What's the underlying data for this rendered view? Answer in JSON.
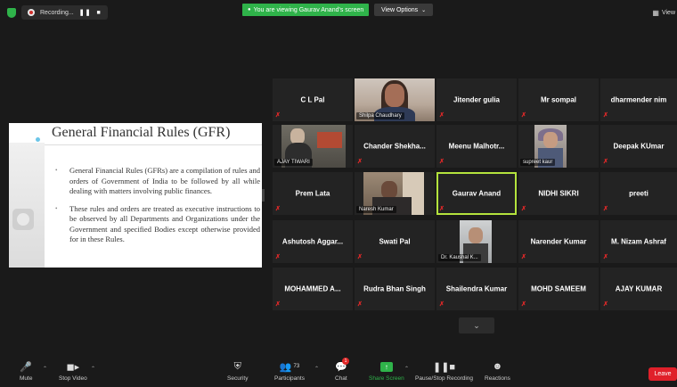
{
  "topbar": {
    "recording_label": "Recording...",
    "viewing_banner": "You are viewing Gaurav Anand's screen",
    "view_options_label": "View Options",
    "view_label": "View"
  },
  "slide": {
    "title": "General Financial Rules (GFR)",
    "bullets": [
      "General Financial Rules (GFRs) are a compilation of rules and orders of Government of India to be followed by all while dealing with matters involving public finances.",
      "These rules and orders are treated as executive instructions to be observed by all Departments and Organizations under the Government and specified Bodies except otherwise provided for in these Rules."
    ]
  },
  "participants": [
    {
      "name": "C L Pal",
      "video": false
    },
    {
      "name": "Shilpa Chaudhary",
      "video": true
    },
    {
      "name": "Jitender gulia",
      "video": false
    },
    {
      "name": "Mr sompal",
      "video": false
    },
    {
      "name": "dharmender nim",
      "video": false
    },
    {
      "name": "AJAY TIWARI",
      "video": true
    },
    {
      "name": "Chander Shekha...",
      "video": false
    },
    {
      "name": "Meenu Malhotr...",
      "video": false
    },
    {
      "name": "supreet kaur",
      "video": true
    },
    {
      "name": "Deepak KUmar",
      "video": false
    },
    {
      "name": "Prem Lata",
      "video": false
    },
    {
      "name": "Naresh Kumar",
      "video": true
    },
    {
      "name": "Gaurav Anand",
      "video": false,
      "active": true
    },
    {
      "name": "NIDHI SIKRI",
      "video": false
    },
    {
      "name": "preeti",
      "video": false
    },
    {
      "name": "Ashutosh Aggar...",
      "video": false
    },
    {
      "name": "Swati Pal",
      "video": false
    },
    {
      "name": "Dr. Kaushal K...",
      "video": true
    },
    {
      "name": "Narender Kumar",
      "video": false
    },
    {
      "name": "M. Nizam Ashraf",
      "video": false
    },
    {
      "name": "MOHAMMED A...",
      "video": false
    },
    {
      "name": "Rudra Bhan Singh",
      "video": false
    },
    {
      "name": "Shailendra Kumar",
      "video": false
    },
    {
      "name": "MOHD SAMEEM",
      "video": false
    },
    {
      "name": "AJAY KUMAR",
      "video": false
    }
  ],
  "toolbar": {
    "mute": "Mute",
    "stop_video": "Stop Video",
    "security": "Security",
    "participants": "Participants",
    "participants_count": "73",
    "chat": "Chat",
    "chat_badge": "1",
    "share_screen": "Share Screen",
    "pause_recording": "Pause/Stop Recording",
    "reactions": "Reactions",
    "leave": "Leave"
  },
  "colors": {
    "active_border": "#b4e33d",
    "muted_mic": "#e02828",
    "share_green": "#2fb34a",
    "leave_red": "#e0202a"
  }
}
